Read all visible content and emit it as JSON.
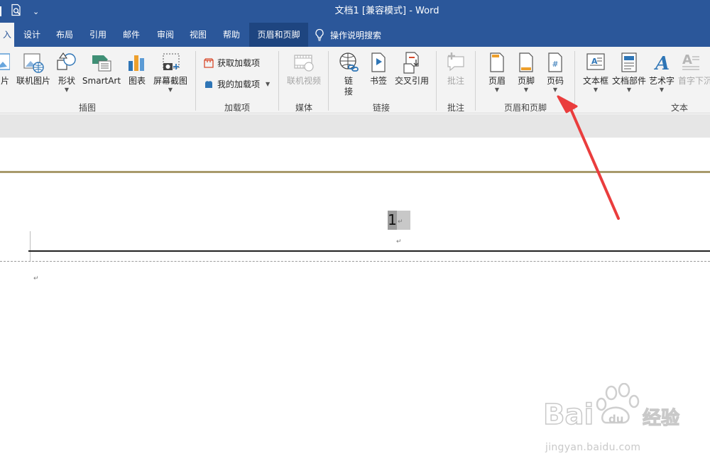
{
  "window": {
    "title": "文档1 [兼容模式] - Word"
  },
  "qat": {
    "overflow": "⌄"
  },
  "tabs": {
    "insert_partial": "入",
    "items": [
      "设计",
      "布局",
      "引用",
      "邮件",
      "审阅",
      "视图",
      "帮助"
    ],
    "context_tab": "页眉和页脚",
    "tell_me": "操作说明搜索"
  },
  "ribbon": {
    "illustrations": {
      "picture_partial": "片",
      "online_pictures": "联机图片",
      "shapes": "形状",
      "smartart": "SmartArt",
      "chart": "图表",
      "screenshot": "屏幕截图",
      "label": "插图"
    },
    "addins": {
      "get_addins": "获取加载项",
      "my_addins": "我的加载项",
      "label": "加载项"
    },
    "media": {
      "online_video": "联机视频",
      "label": "媒体"
    },
    "links": {
      "link": "链\n接",
      "bookmark": "书签",
      "cross_ref": "交叉引用",
      "label": "链接"
    },
    "comments": {
      "comment": "批注",
      "label": "批注"
    },
    "header_footer": {
      "header": "页眉",
      "footer": "页脚",
      "page_number": "页码",
      "label": "页眉和页脚",
      "icon_glyph": "#"
    },
    "text": {
      "textbox": "文本框",
      "quick_parts": "文档部件",
      "wordart": "艺术字",
      "dropcap_partial": "首字下沉",
      "label": "文本"
    }
  },
  "document": {
    "page_number": "1",
    "para_mark": "↵"
  },
  "watermark": {
    "url": "jingyan.baidu.com"
  },
  "colors": {
    "brand": "#2b579a",
    "ribbon_bg": "#f3f3f3",
    "arrow": "#ea3d3d",
    "gold_rule": "#a89a6b"
  }
}
